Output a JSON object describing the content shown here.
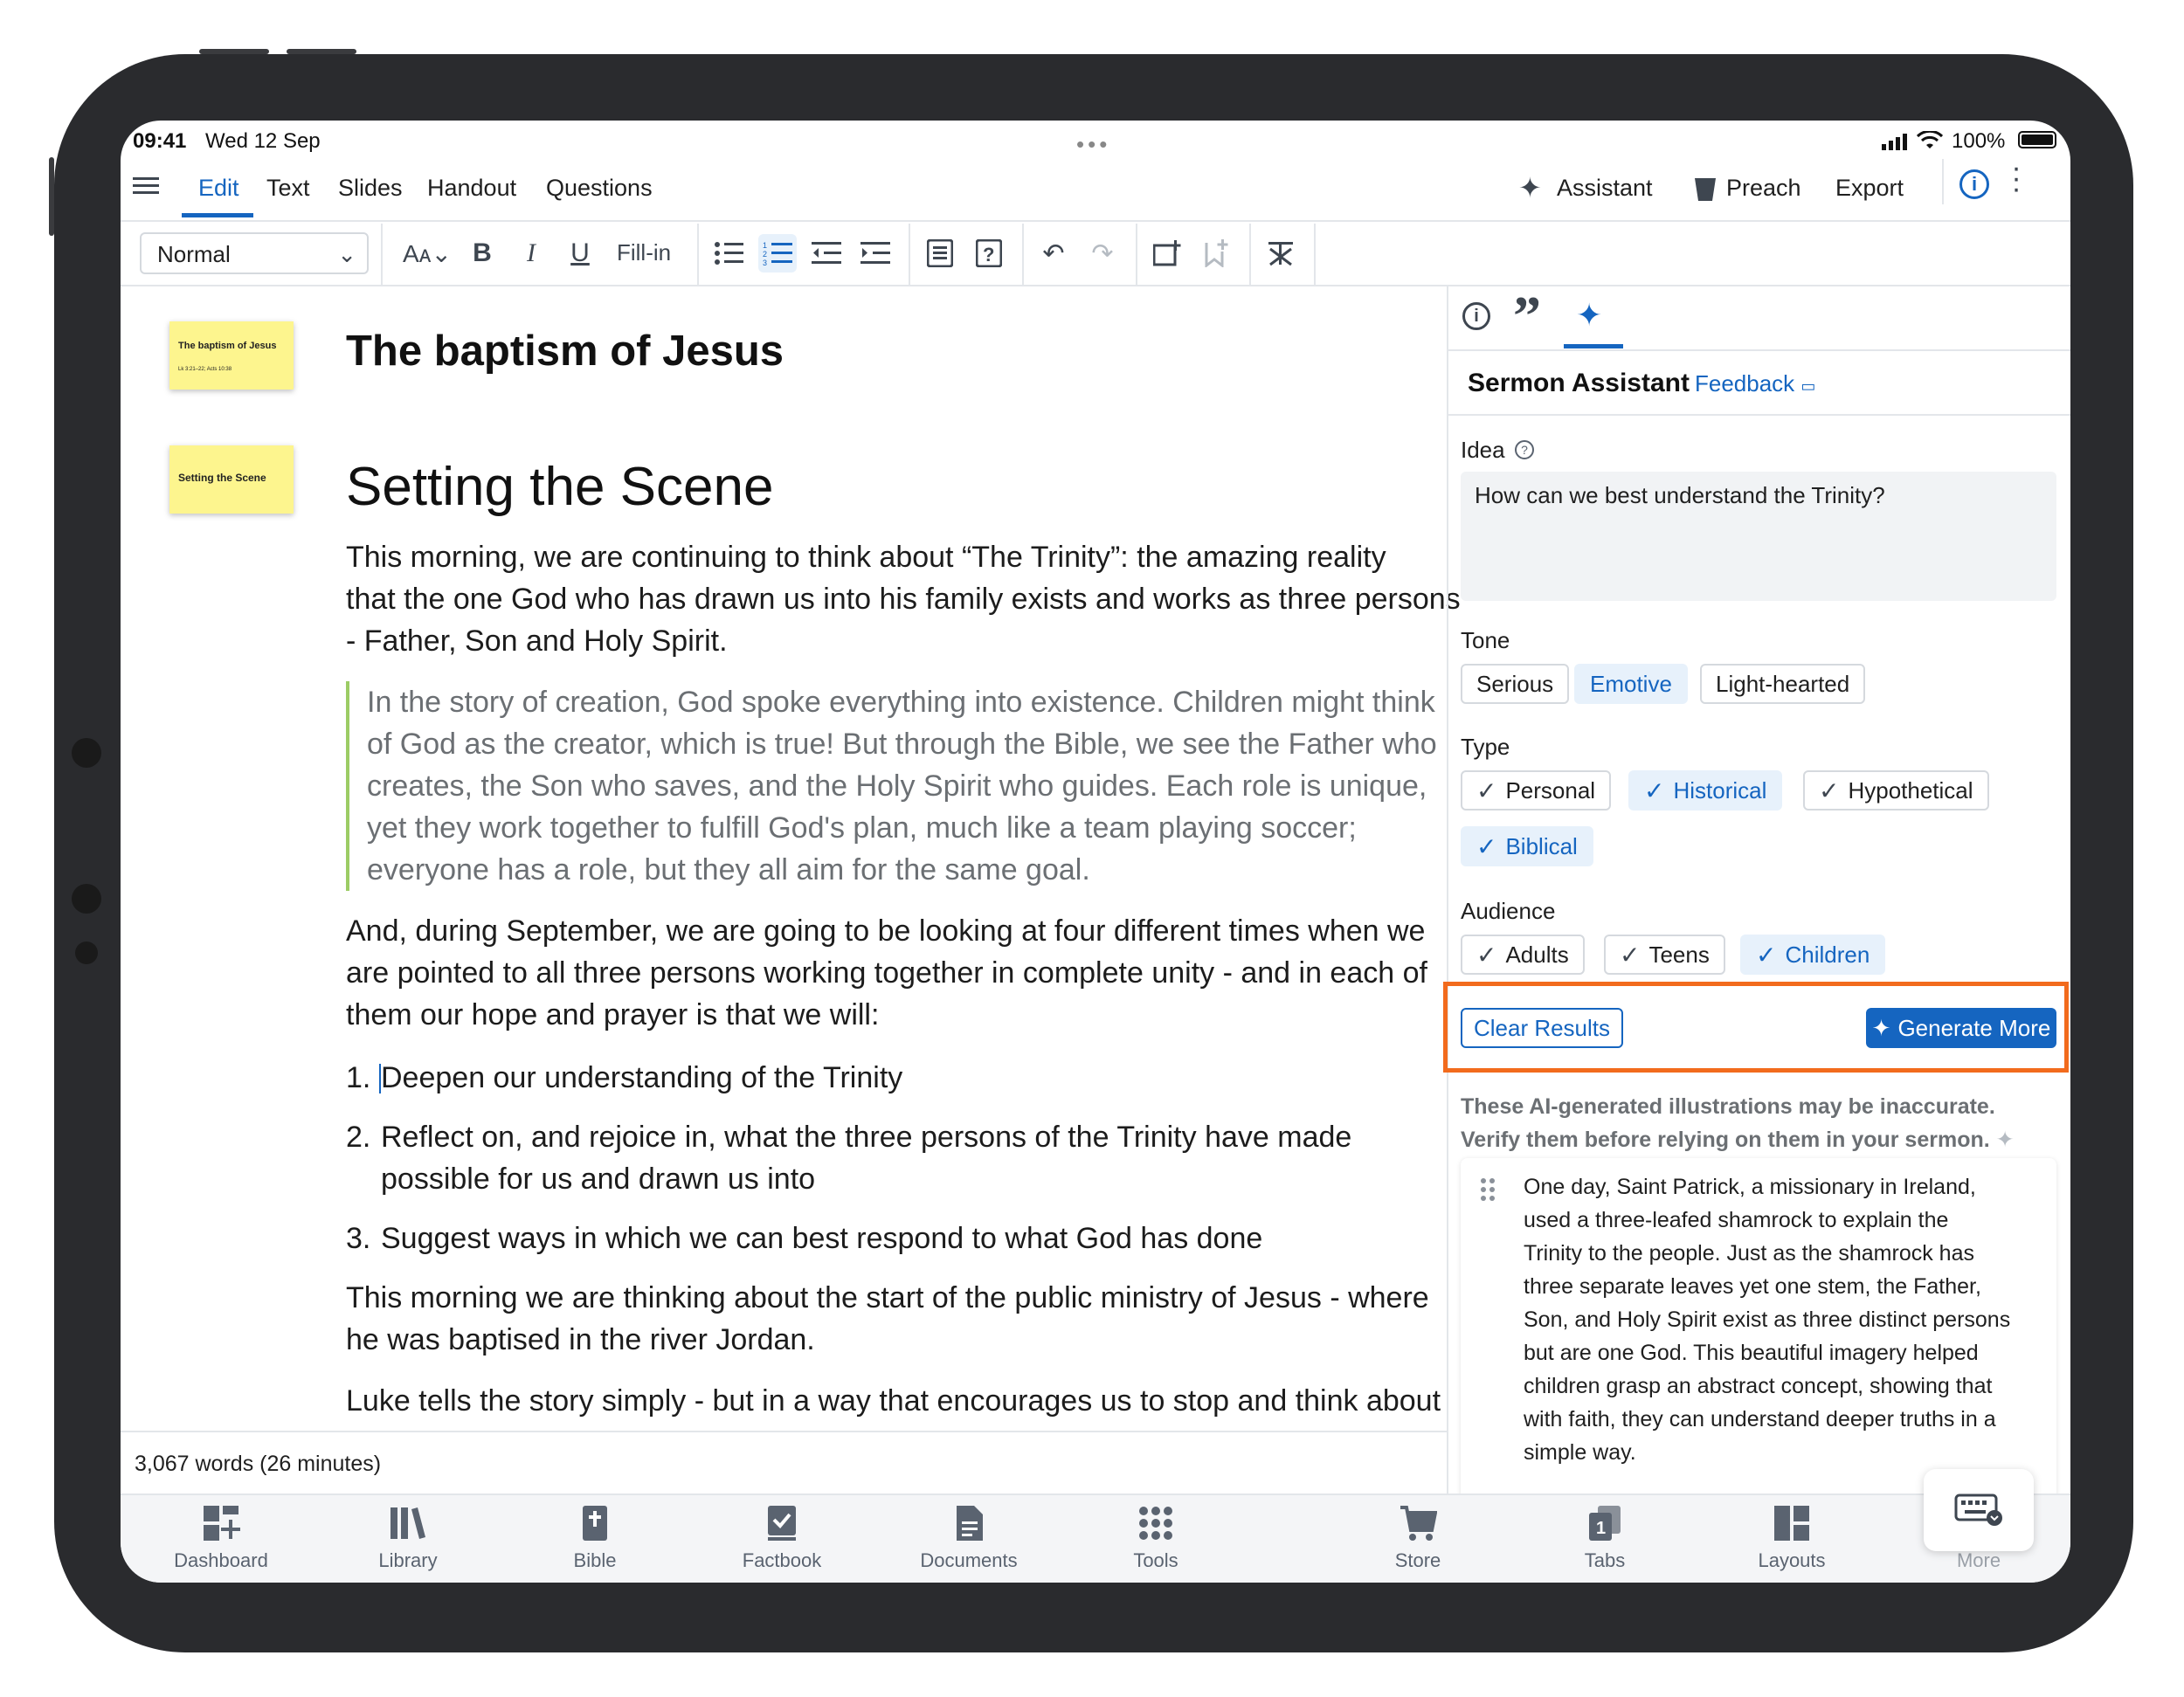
{
  "status_bar": {
    "time": "09:41",
    "date": "Wed 12 Sep",
    "battery": "100%"
  },
  "menu": {
    "items": [
      "Edit",
      "Text",
      "Slides",
      "Handout",
      "Questions"
    ],
    "assistant": "Assistant",
    "preach": "Preach",
    "export": "Export"
  },
  "toolbar": {
    "style_select": "Normal",
    "fill_in": "Fill-in"
  },
  "document": {
    "thumb1": {
      "title": "The baptism of Jesus",
      "sub": "Lk 3:21–22; Acts 10:38"
    },
    "thumb2": {
      "title": "Setting the Scene"
    },
    "title": "The baptism of Jesus",
    "heading": "Setting the Scene",
    "p1": [
      "This morning, we are continuing to think about “The Trinity”: the amazing reality",
      "that the one God who has drawn us into his family exists and works as three persons",
      "- Father, Son and Holy Spirit."
    ],
    "quote": [
      "In the story of creation, God spoke everything into existence. Children might think",
      "of God as the creator, which is true! But through the Bible, we see the Father who",
      "creates, the Son who saves, and the Holy Spirit who guides. Each role is unique,",
      "yet they work together to fulfill God's plan, much like a team playing soccer;",
      "everyone has a role, but they all aim for the same goal."
    ],
    "p2": [
      "And, during September, we are going to be looking at four different times when we",
      "are pointed to all three persons working together in complete unity - and in each of",
      "them our hope and prayer is that we will:"
    ],
    "list": [
      {
        "num": "1.",
        "lines": [
          "Deepen our understanding of the Trinity"
        ]
      },
      {
        "num": "2.",
        "lines": [
          "Reflect on, and rejoice in, what the three persons of the Trinity have made",
          "possible for us and drawn us into"
        ]
      },
      {
        "num": "3.",
        "lines": [
          "Suggest ways in which we can best respond to what God has done"
        ]
      }
    ],
    "p3": [
      "This morning we are thinking about the start of the public ministry of Jesus - where",
      "he was  baptised in the river Jordan."
    ],
    "p4": [
      "Luke tells the story simply - but in a way that encourages us to stop and think about"
    ],
    "word_count": "3,067 words (26 minutes)"
  },
  "panel": {
    "title": "Sermon Assistant",
    "feedback": "Feedback",
    "idea_label": "Idea",
    "idea_value": "How can we best understand the Trinity?",
    "tone_label": "Tone",
    "tones": [
      {
        "label": "Serious",
        "selected": false
      },
      {
        "label": "Emotive",
        "selected": true
      },
      {
        "label": "Light-hearted",
        "selected": false
      }
    ],
    "type_label": "Type",
    "types": [
      {
        "label": "Personal",
        "selected": false
      },
      {
        "label": "Historical",
        "selected": true
      },
      {
        "label": "Hypothetical",
        "selected": false
      },
      {
        "label": "Biblical",
        "selected": true
      }
    ],
    "audience_label": "Audience",
    "audiences": [
      {
        "label": "Adults",
        "selected": false
      },
      {
        "label": "Teens",
        "selected": false
      },
      {
        "label": "Children",
        "selected": true
      }
    ],
    "clear_results": "Clear Results",
    "generate_more": "Generate More",
    "disclaimer": [
      "These AI-generated illustrations may be inaccurate.",
      "Verify them before relying on them in your sermon."
    ],
    "result_text": [
      "One day, Saint Patrick, a missionary in Ireland,",
      "used a three-leafed shamrock to explain the",
      "Trinity to the people. Just as the shamrock has",
      "three separate leaves yet one stem, the Father,",
      "Son, and Holy Spirit exist as three distinct persons",
      "but are one God. This beautiful imagery helped",
      "children grasp an abstract concept, showing that",
      "with faith, they can understand deeper truths in a",
      "simple way."
    ]
  },
  "tabbar": [
    "Dashboard",
    "Library",
    "Bible",
    "Factbook",
    "Documents",
    "Tools",
    "Store",
    "Tabs",
    "Layouts",
    "More"
  ],
  "colors": {
    "accent": "#1565c0",
    "highlight_box": "#f26b1d",
    "note_yellow": "#fdf58e"
  }
}
